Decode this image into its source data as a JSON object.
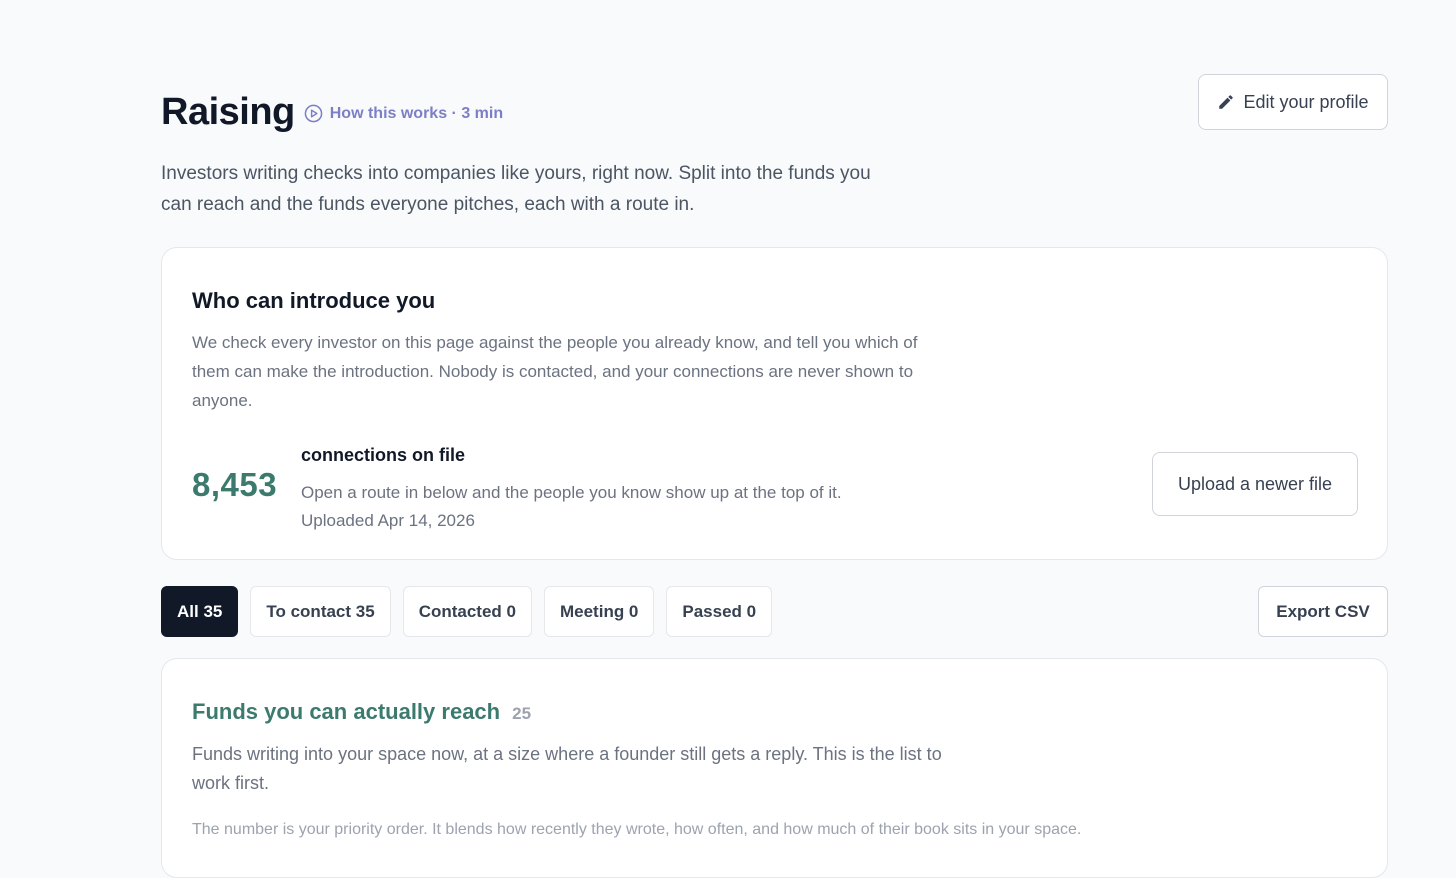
{
  "header": {
    "title": "Raising",
    "how_link": "How this works · 3 min",
    "edit_profile": "Edit your profile",
    "intro": "Investors writing checks into companies like yours, right now. Split into the funds you can reach and the funds everyone pitches, each with a route in."
  },
  "introductions": {
    "title": "Who can introduce you",
    "description": "We check every investor on this page against the people you already know, and tell you which of them can make the introduction. Nobody is contacted, and your connections are never shown to anyone.",
    "count": "8,453",
    "count_label": "connections on file",
    "hint": "Open a route in below and the people you know show up at the top of it.",
    "uploaded": "Uploaded Apr 14, 2026",
    "upload_button": "Upload a newer file"
  },
  "filters": {
    "tabs": [
      {
        "label": "All 35",
        "active": true
      },
      {
        "label": "To contact 35",
        "active": false
      },
      {
        "label": "Contacted 0",
        "active": false
      },
      {
        "label": "Meeting 0",
        "active": false
      },
      {
        "label": "Passed 0",
        "active": false
      }
    ],
    "export": "Export CSV"
  },
  "funds": {
    "title": "Funds you can actually reach",
    "count": "25",
    "description": "Funds writing into your space now, at a size where a founder still gets a reply. This is the list to work first.",
    "note": "The number is your priority order. It blends how recently they wrote, how often, and how much of their book sits in your space."
  },
  "colors": {
    "accent_green": "#3d7a6e",
    "link_purple": "#7c7fc6",
    "active_tab": "#111827"
  },
  "icons": {
    "how_link": "play-circle-icon",
    "edit": "pencil-icon"
  }
}
